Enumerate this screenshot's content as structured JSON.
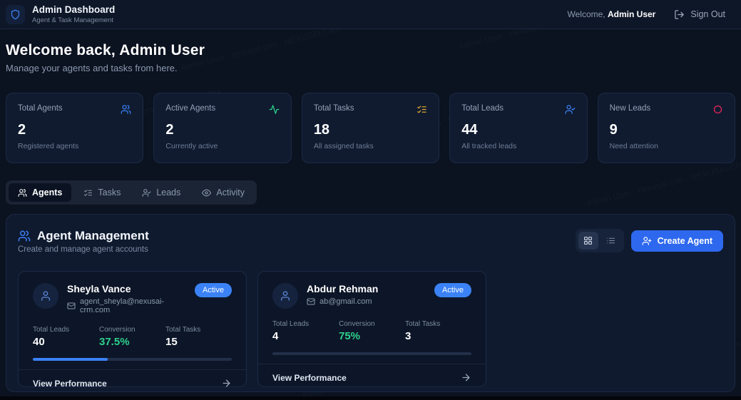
{
  "header": {
    "title": "Admin Dashboard",
    "subtitle": "Agent & Task Management",
    "welcome_prefix": "Welcome,",
    "user_name": "Admin User",
    "sign_out_label": "Sign Out"
  },
  "hero": {
    "title": "Welcome back, Admin User",
    "subtitle": "Manage your agents and tasks from here."
  },
  "stats": [
    {
      "label": "Total Agents",
      "value": "2",
      "sub": "Registered agents",
      "icon": "users-icon",
      "icon_color": "#3b82f6"
    },
    {
      "label": "Active Agents",
      "value": "2",
      "sub": "Currently active",
      "icon": "activity-icon",
      "icon_color": "#2fd08c"
    },
    {
      "label": "Total Tasks",
      "value": "18",
      "sub": "All assigned tasks",
      "icon": "task-list-icon",
      "icon_color": "#d9a32e"
    },
    {
      "label": "Total Leads",
      "value": "44",
      "sub": "All tracked leads",
      "icon": "user-check-icon",
      "icon_color": "#3b82f6"
    },
    {
      "label": "New Leads",
      "value": "9",
      "sub": "Need attention",
      "icon": "circle-icon",
      "icon_color": "#d82457"
    }
  ],
  "tabs": [
    {
      "label": "Agents",
      "icon": "users-icon",
      "active": true
    },
    {
      "label": "Tasks",
      "icon": "task-list-icon",
      "active": false
    },
    {
      "label": "Leads",
      "icon": "user-check-icon",
      "active": false
    },
    {
      "label": "Activity",
      "icon": "eye-icon",
      "active": false
    }
  ],
  "agent_section": {
    "title": "Agent Management",
    "subtitle": "Create and manage agent accounts",
    "create_button_label": "Create Agent"
  },
  "agent_stat_labels": {
    "leads": "Total Leads",
    "conversion": "Conversion",
    "tasks": "Total Tasks"
  },
  "agents": [
    {
      "name": "Sheyla Vance",
      "email": "agent_sheyla@nexusai-crm.com",
      "status": "Active",
      "total_leads": "40",
      "conversion": "37.5%",
      "total_tasks": "15",
      "progress_percent": 37.5,
      "link_label": "View Performance"
    },
    {
      "name": "Abdur Rehman",
      "email": "ab@gmail.com",
      "status": "Active",
      "total_leads": "4",
      "conversion": "75%",
      "total_tasks": "3",
      "progress_percent": 0,
      "link_label": "View Performance"
    }
  ],
  "colors": {
    "accent_blue": "#3b82f6",
    "success_green": "#2fd08c",
    "warning_amber": "#d9a32e",
    "alert_red": "#d82457",
    "page_bg": "#0b1220"
  },
  "watermark": {
    "text": "Admin User · nexusai-crm · NEXUSAI-CRM"
  }
}
